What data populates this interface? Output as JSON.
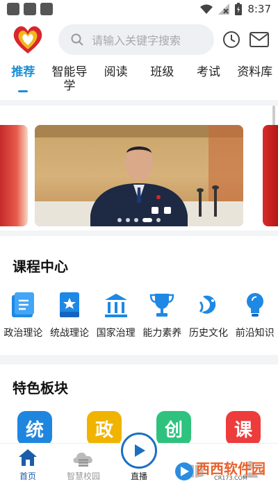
{
  "status": {
    "time": "8:37"
  },
  "search": {
    "placeholder": "请输入关键字搜索"
  },
  "tabs": [
    "推荐",
    "智能导\n学",
    "阅读",
    "班级",
    "考试",
    "资料库"
  ],
  "banner": {
    "dots": 5,
    "active_dot": 3
  },
  "course_center": {
    "title": "课程中心",
    "items": [
      {
        "label": "政治理论",
        "icon": "book-list-icon"
      },
      {
        "label": "统战理论",
        "icon": "star-book-icon"
      },
      {
        "label": "国家治理",
        "icon": "bank-building-icon"
      },
      {
        "label": "能力素养",
        "icon": "trophy-icon"
      },
      {
        "label": "历史文化",
        "icon": "dragon-icon"
      },
      {
        "label": "前沿知识",
        "icon": "lightbulb-icon"
      }
    ]
  },
  "featured": {
    "title": "特色板块",
    "items": [
      {
        "char": "统",
        "color": "#1f86e0"
      },
      {
        "char": "政",
        "color": "#f0b400"
      },
      {
        "char": "创",
        "color": "#2ec27e"
      },
      {
        "char": "课",
        "color": "#ee3b3b"
      }
    ]
  },
  "bottom_nav": [
    {
      "label": "首页",
      "icon": "home-icon"
    },
    {
      "label": "智慧校园",
      "icon": "cloud-books-icon"
    },
    {
      "label": "直播",
      "icon": "play-icon"
    },
    {
      "label": "",
      "icon": "book-open-icon"
    },
    {
      "label": "",
      "icon": "person-icon"
    }
  ],
  "watermark": {
    "text": "西西软件园",
    "sub": "CR173.COM"
  },
  "colors": {
    "accent": "#1a8fd6",
    "icon_blue": "#1e88e5"
  }
}
